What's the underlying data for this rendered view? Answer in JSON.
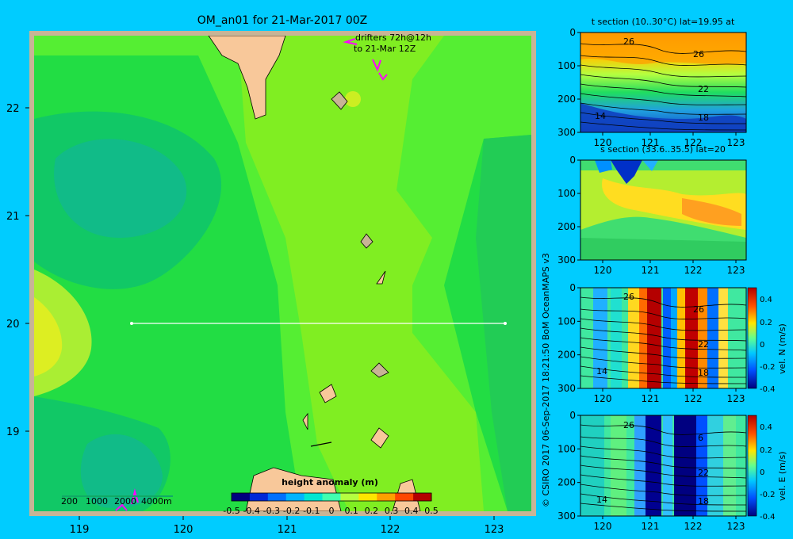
{
  "main_map": {
    "title": "OM_an01 for 21-Mar-2017 00Z",
    "drifter_note_line1": "drifters 72h@12h",
    "drifter_note_line2": "to 21-Mar 12Z",
    "lon_ticks": [
      "119",
      "120",
      "121",
      "122",
      "123"
    ],
    "lat_ticks": [
      "22",
      "21",
      "20",
      "19"
    ],
    "section_line": {
      "lat": 20,
      "lon_start": 119.5,
      "lon_end": 123.2
    },
    "depth_legend": [
      "200",
      "1000",
      "2000",
      "4000m"
    ],
    "colorbar_title": "height anomaly (m)",
    "colorbar_ticks": [
      "-0.5",
      "-0.4",
      "-0.3",
      "-0.2",
      "-0.1",
      "0",
      "0.1",
      "0.2",
      "0.3",
      "0.4",
      "0.5"
    ],
    "colorbar_colors": [
      "#00007f",
      "#0028d8",
      "#0070ff",
      "#00b4ff",
      "#00e6d2",
      "#40ffb0",
      "#b4ff40",
      "#ffe600",
      "#ffa000",
      "#ff4600",
      "#b40000"
    ]
  },
  "copyright": "© CSIRO 2017   06-Sep-2017 18:21:50 BoM OceanMAPS v3",
  "panels": [
    {
      "id": "t-section",
      "title": "t section (10..30°C) lat=19.95 at",
      "depth_ticks": [
        "0",
        "100",
        "200",
        "300"
      ],
      "lon_ticks": [
        "120",
        "121",
        "122",
        "123"
      ],
      "contour_labels": [
        "26",
        "26",
        "22",
        "18",
        "14"
      ]
    },
    {
      "id": "s-section",
      "title": "s section (33.6..35.5) lat=20",
      "depth_ticks": [
        "0",
        "100",
        "200",
        "300"
      ],
      "lon_ticks": [
        "120",
        "121",
        "122",
        "123"
      ],
      "contour_labels": []
    },
    {
      "id": "vn-section",
      "title": "",
      "depth_ticks": [
        "0",
        "100",
        "200",
        "300"
      ],
      "lon_ticks": [
        "120",
        "121",
        "122",
        "123"
      ],
      "contour_labels": [
        "26",
        "26",
        "22",
        "18",
        "14"
      ],
      "colorbar_label": "vel. N (m/s)",
      "colorbar_ticks": [
        "0.4",
        "0.2",
        "0",
        "-0.2",
        "-0.4"
      ]
    },
    {
      "id": "ve-section",
      "title": "",
      "depth_ticks": [
        "0",
        "100",
        "200",
        "300"
      ],
      "lon_ticks": [
        "120",
        "121",
        "122",
        "123"
      ],
      "contour_labels": [
        "26",
        "6",
        "22",
        "18",
        "14"
      ],
      "colorbar_label": "vel. E (m/s)",
      "colorbar_ticks": [
        "0.4",
        "0.2",
        "0",
        "-0.2",
        "-0.4"
      ]
    }
  ]
}
